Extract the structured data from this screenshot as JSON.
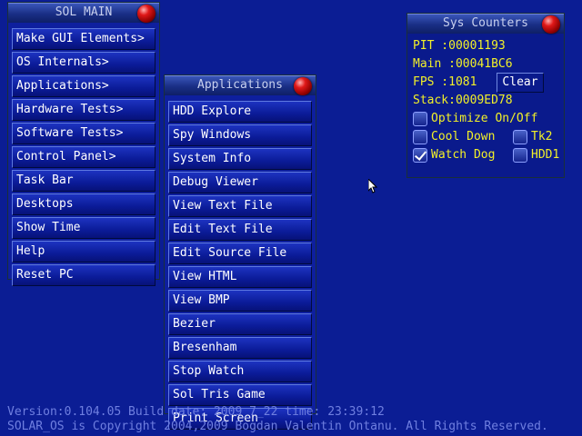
{
  "sol_main": {
    "title": "SOL MAIN",
    "items": [
      {
        "label": "Make GUI Elements>"
      },
      {
        "label": "OS Internals>"
      },
      {
        "label": "Applications>"
      },
      {
        "label": "Hardware Tests>"
      },
      {
        "label": "Software Tests>"
      },
      {
        "label": "Control Panel>"
      },
      {
        "label": "Task Bar"
      },
      {
        "label": "Desktops"
      },
      {
        "label": "Show Time"
      },
      {
        "label": "Help"
      },
      {
        "label": "Reset PC"
      }
    ]
  },
  "applications": {
    "title": "Applications",
    "items": [
      {
        "label": "HDD Explore"
      },
      {
        "label": "Spy Windows"
      },
      {
        "label": "System Info"
      },
      {
        "label": "Debug Viewer"
      },
      {
        "label": "View Text File"
      },
      {
        "label": "Edit Text File"
      },
      {
        "label": "Edit Source File"
      },
      {
        "label": "View HTML"
      },
      {
        "label": "View BMP"
      },
      {
        "label": "Bezier"
      },
      {
        "label": "Bresenham"
      },
      {
        "label": "Stop Watch"
      },
      {
        "label": "Sol Tris Game"
      },
      {
        "label": "Print Screen"
      }
    ]
  },
  "sys_counters": {
    "title": "Sys Counters",
    "pit_label": "PIT  :",
    "pit_value": "00001193",
    "main_label": "Main :",
    "main_value": "00041BC6",
    "fps_label": "FPS  :",
    "fps_value": "1081",
    "clear_label": "Clear",
    "stack_label": "Stack:",
    "stack_value": "0009ED78",
    "checkboxes": {
      "optimize": {
        "label": "Optimize On/Off",
        "checked": false
      },
      "cool_down": {
        "label": "Cool Down",
        "checked": false
      },
      "tk2": {
        "label": "Tk2",
        "checked": false
      },
      "watch_dog": {
        "label": "Watch Dog",
        "checked": true
      },
      "hdd1": {
        "label": "HDD1",
        "checked": false
      }
    }
  },
  "footer": {
    "version_line": "Version:0.104.05  Build date: 2009_7_22  time: 23:39:12",
    "copyright_line": "SOLAR_OS is Copyright 2004,2009 Bogdan Valentin Ontanu. All Rights Reserved."
  },
  "colors": {
    "desktop": "#0b1d94",
    "counter_text": "#f2f028",
    "footer_text": "#6f7fe0",
    "close_ball": "#e01818"
  }
}
